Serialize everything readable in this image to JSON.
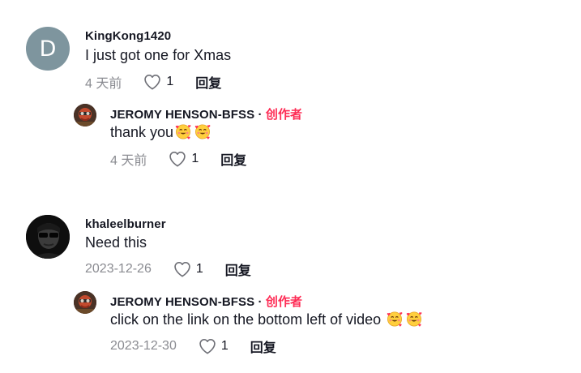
{
  "comments": [
    {
      "username": "KingKong1420",
      "avatar_letter": "D",
      "text": "I just got one for Xmas",
      "time": "4 天前",
      "likes": "1",
      "reply_label": "回复",
      "reply": {
        "username": "JEROMY HENSON-BFSS",
        "separator": " · ",
        "creator_label": "创作者",
        "text": "thank you",
        "emoji_count": 2,
        "time": "4 天前",
        "likes": "1",
        "reply_label": "回复"
      }
    },
    {
      "username": "khaleelburner",
      "text": "Need this",
      "time": "2023-12-26",
      "likes": "1",
      "reply_label": "回复",
      "reply": {
        "username": "JEROMY HENSON-BFSS",
        "separator": " · ",
        "creator_label": "创作者",
        "text": "click on the link on the bottom left of video ",
        "emoji_count": 2,
        "time": "2023-12-30",
        "likes": "1",
        "reply_label": "回复"
      }
    }
  ],
  "colors": {
    "creator_accent": "#fe2c55",
    "meta_gray": "#8a8b91",
    "avatar_gray": "#7e959e"
  },
  "icons": {
    "like": "heart-outline-icon",
    "emoji": "smiling-face-with-hearts-emoji"
  }
}
